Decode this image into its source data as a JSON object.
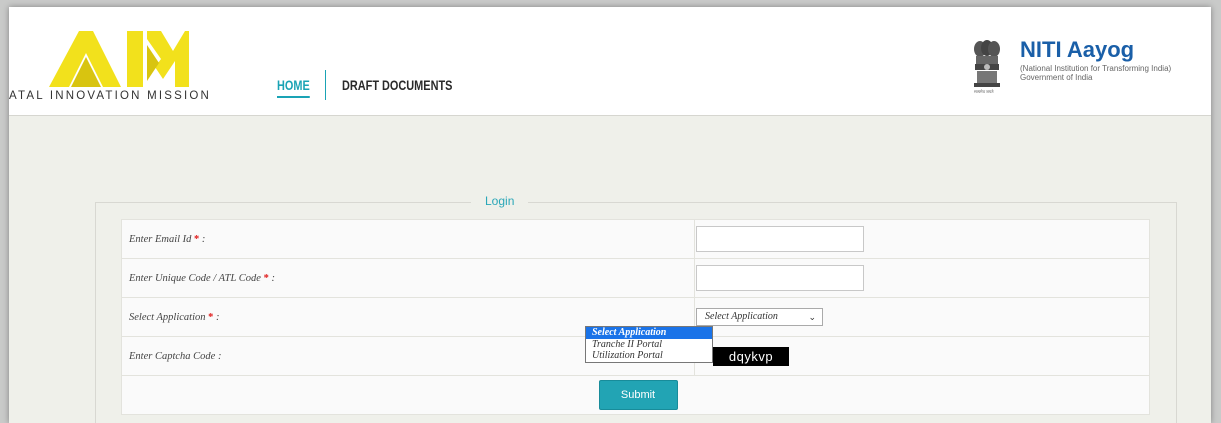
{
  "header": {
    "brand_subtitle": "ATAL INNOVATION MISSION",
    "nav": {
      "home": "HOME",
      "draft_documents": "DRAFT DOCUMENTS"
    },
    "niti": {
      "title": "NITI Aayog",
      "subtitle1": "(National Institution for Transforming India)",
      "subtitle2": "Government of India",
      "emblem_caption": "सत्यमेव जयते"
    }
  },
  "login": {
    "legend": "Login",
    "fields": {
      "email_label": "Enter Email Id ",
      "unique_code_label": "Enter Unique Code / ATL Code ",
      "application_label": "Select Application ",
      "captcha_label": "Enter Captcha Code :",
      "required_mark": "*",
      "label_suffix": " :"
    },
    "inputs": {
      "email_value": "",
      "unique_code_value": ""
    },
    "application_select": {
      "selected": "Select Application",
      "options": [
        "Select Application",
        "Tranche II Portal",
        "Utilization Portal"
      ]
    },
    "captcha_text": "dqykvp",
    "submit_label": "Submit"
  },
  "colors": {
    "accent": "#22a4b4",
    "required": "#e01b1b",
    "niti_blue": "#1a5fa8"
  }
}
